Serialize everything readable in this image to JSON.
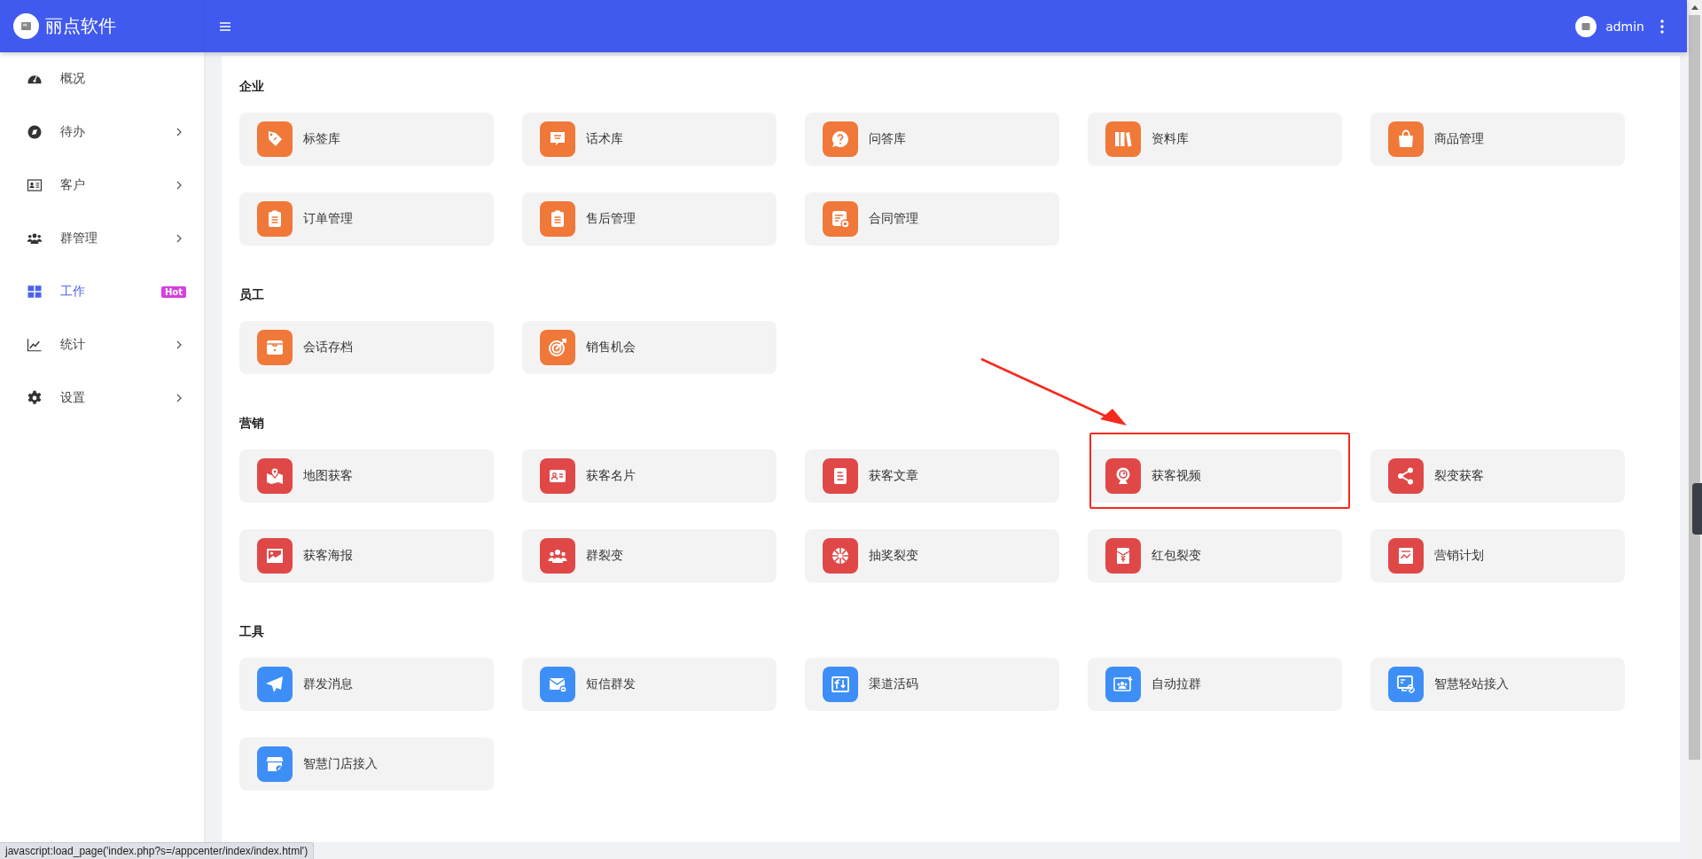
{
  "header": {
    "brand": "丽点软件",
    "user": "admin"
  },
  "sidebar": {
    "items": [
      {
        "label": "概况",
        "selected": false,
        "expandable": false
      },
      {
        "label": "待办",
        "selected": false,
        "expandable": true
      },
      {
        "label": "客户",
        "selected": false,
        "expandable": true
      },
      {
        "label": "群管理",
        "selected": false,
        "expandable": true
      },
      {
        "label": "工作",
        "selected": true,
        "expandable": false,
        "badge": "Hot"
      },
      {
        "label": "统计",
        "selected": false,
        "expandable": true
      },
      {
        "label": "设置",
        "selected": false,
        "expandable": true
      }
    ]
  },
  "sections": [
    {
      "title": "企业",
      "color": "#f07838",
      "apps": [
        {
          "label": "标签库",
          "highlighted": false
        },
        {
          "label": "话术库",
          "highlighted": false
        },
        {
          "label": "问答库",
          "highlighted": false
        },
        {
          "label": "资料库",
          "highlighted": false
        },
        {
          "label": "商品管理",
          "highlighted": false
        },
        {
          "label": "订单管理",
          "highlighted": false
        },
        {
          "label": "售后管理",
          "highlighted": false
        },
        {
          "label": "合同管理",
          "highlighted": false
        }
      ]
    },
    {
      "title": "员工",
      "color": "#f07838",
      "apps": [
        {
          "label": "会话存档",
          "highlighted": false
        },
        {
          "label": "销售机会",
          "highlighted": false
        }
      ]
    },
    {
      "title": "营销",
      "color": "#e04848",
      "apps": [
        {
          "label": "地图获客",
          "highlighted": false
        },
        {
          "label": "获客名片",
          "highlighted": false
        },
        {
          "label": "获客文章",
          "highlighted": false
        },
        {
          "label": "获客视频",
          "highlighted": true
        },
        {
          "label": "裂变获客",
          "highlighted": false
        },
        {
          "label": "获客海报",
          "highlighted": false
        },
        {
          "label": "群裂变",
          "highlighted": false
        },
        {
          "label": "抽奖裂变",
          "highlighted": false
        },
        {
          "label": "红包裂变",
          "highlighted": false
        },
        {
          "label": "营销计划",
          "highlighted": false
        }
      ]
    },
    {
      "title": "工具",
      "color": "#3d8ef7",
      "apps": [
        {
          "label": "群发消息",
          "highlighted": false
        },
        {
          "label": "短信群发",
          "highlighted": false
        },
        {
          "label": "渠道活码",
          "highlighted": false
        },
        {
          "label": "自动拉群",
          "highlighted": false
        },
        {
          "label": "智慧轻站接入",
          "highlighted": false
        },
        {
          "label": "智慧门店接入",
          "highlighted": false
        }
      ]
    }
  ],
  "status_bar": {
    "url": "javascript:load_page('index.php?s=/appcenter/index/index.html')"
  }
}
